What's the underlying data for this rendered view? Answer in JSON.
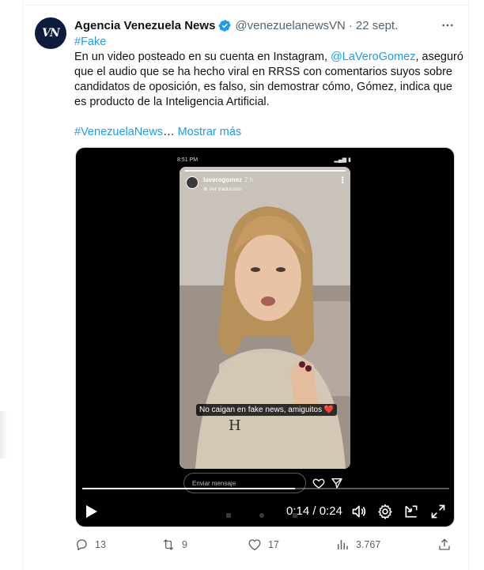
{
  "tweet": {
    "author_name": "Agencia Venezuela News",
    "handle": "@venezuelanewsVN",
    "separator": "·",
    "date": "22 sept.",
    "avatar_text": "VN",
    "lines": [
      [
        {
          "t": "#Fake",
          "link": true
        }
      ],
      [
        {
          "t": "En un video posteado en su cuenta en Instagram, ",
          "link": false
        },
        {
          "t": "@LaVeroGomez",
          "link": true
        },
        {
          "t": ", aseguró",
          "link": false
        }
      ],
      [
        {
          "t": "que el audio que se ha hecho viral en RRSS con comentarios suyos sobre",
          "link": false
        }
      ],
      [
        {
          "t": "candidatos de oposición, es falso, sin demostrar cómo, Gómez, indica que",
          "link": false
        }
      ],
      [
        {
          "t": "es producto de la Inteligencia Artificial.",
          "link": false
        }
      ]
    ],
    "footer_hashtag": "#VenezuelaNews",
    "footer_ellipsis": "…",
    "show_more": "Mostrar más"
  },
  "video": {
    "phone_time": "8:51 PM",
    "story_username": "laverogomez",
    "story_time": "2 h",
    "story_translate": "Ver traducción",
    "caption": "No caigan en fake news, amiguitos",
    "caption_emoji": "❤️",
    "message_placeholder": "Enviar mensaje",
    "current_time": "0:14",
    "duration": "0:24",
    "time_separator": " / ",
    "progress": 0.58
  },
  "actions": {
    "replies": "13",
    "reposts": "9",
    "likes": "17",
    "views": "3.767"
  },
  "colors": {
    "accent": "#1d9bf0",
    "muted": "#536471",
    "text": "#0f1419",
    "verified": "#1d9bf0"
  }
}
